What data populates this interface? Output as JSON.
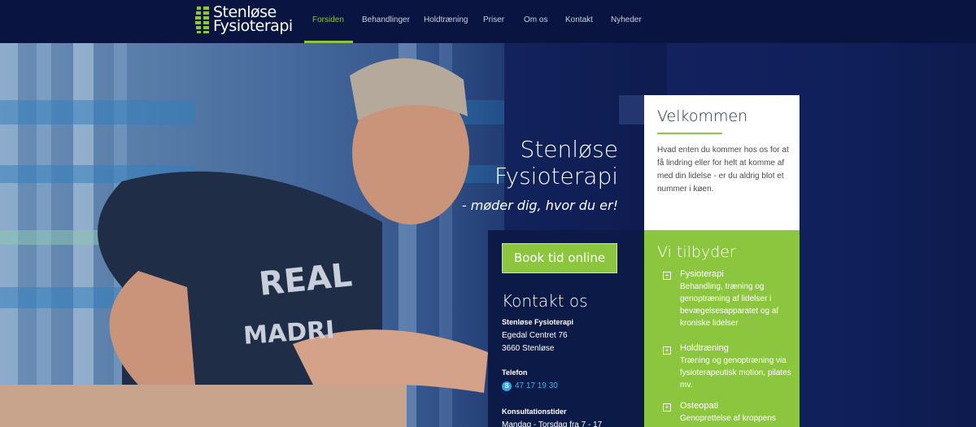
{
  "brand": {
    "line1": "Stenløse",
    "line2": "Fysioterapi"
  },
  "nav": [
    {
      "label": "Forsiden"
    },
    {
      "label": "Behandlinger"
    },
    {
      "label": "Holdtræning"
    },
    {
      "label": "Priser"
    },
    {
      "label": "Om os"
    },
    {
      "label": "Kontakt"
    },
    {
      "label": "Nyheder"
    }
  ],
  "hero": {
    "title_line1": "Stenløse",
    "title_line2": "Fysioterapi",
    "tagline": "- møder dig, hvor du er!"
  },
  "welcome": {
    "title": "Velkommen",
    "text": "Hvad enten du kommer hos os for at få lindring eller for helt at komme af med din lidelse - er du aldrig blot et nummer i køen."
  },
  "contact": {
    "book_button": "Book tid online",
    "title": "Kontakt os",
    "name": "Stenløse Fysioterapi",
    "address1": "Egedal Centret 76",
    "address2": "3660 Stenløse",
    "phone_label": "Telefon",
    "phone": "47 17 19 30",
    "hours_label": "Konsultationstider",
    "hours": "Mandag - Torsdag fra 7 - 17"
  },
  "offer": {
    "title": "Vi tilbyder",
    "items": [
      {
        "head": "Fysioterapi",
        "desc": "Behandling, træning og genoptræning af lidelser i bevægelsesapparatet og af kroniske lidelser"
      },
      {
        "head": "Holdtræning",
        "desc": "Træning og genoptræning via fysioterapeutisk motion, pilates mv."
      },
      {
        "head": "Osteopati",
        "desc": "Genoprettelse af kroppens"
      }
    ]
  },
  "colors": {
    "accent": "#8cc63f",
    "navy": "#0a1440",
    "link": "#3db2ef"
  },
  "icons": {
    "logo": "logo-spine-icon",
    "skype": "skype-icon",
    "offer_bullet": "plus-box-icon"
  }
}
